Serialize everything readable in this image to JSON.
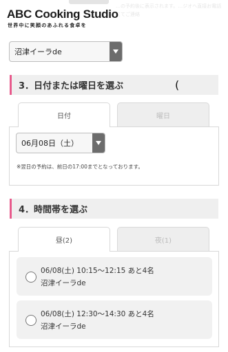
{
  "header": {
    "logo": "ABC Cooking Studio",
    "tagline": "世界中に笑顔のあふれる食卓を",
    "faded_note": "…の予約後に表示されます。…ジオへ直接お電話にてご連絡"
  },
  "store_select": {
    "value": "沼津イーラde"
  },
  "section3": {
    "title": "3．日付または曜日を選ぶ",
    "tabs": [
      {
        "label": "日付",
        "active": true
      },
      {
        "label": "曜日",
        "active": false
      }
    ],
    "date_select": {
      "value": "06月08日（土）"
    },
    "note": "※翌日の予約は、前日の17:00までとなっております。"
  },
  "stray_mark": "(",
  "section4": {
    "title": "4．時間帯を選ぶ",
    "tabs": [
      {
        "label": "昼(2)",
        "active": true
      },
      {
        "label": "夜(1)",
        "active": false
      }
    ],
    "slots": [
      {
        "time": "06/08(土) 10:15〜12:15 あと4名",
        "studio": "沼津イーラde"
      },
      {
        "time": "06/08(土) 12:30〜14:30 あと4名",
        "studio": "沼津イーラde"
      }
    ]
  },
  "colors": {
    "accent": "#e85a8c",
    "select_arrow_bg": "#6c6c6c"
  },
  "icons": {
    "select_arrow": "chevron-down-icon",
    "radio": "radio-icon"
  }
}
